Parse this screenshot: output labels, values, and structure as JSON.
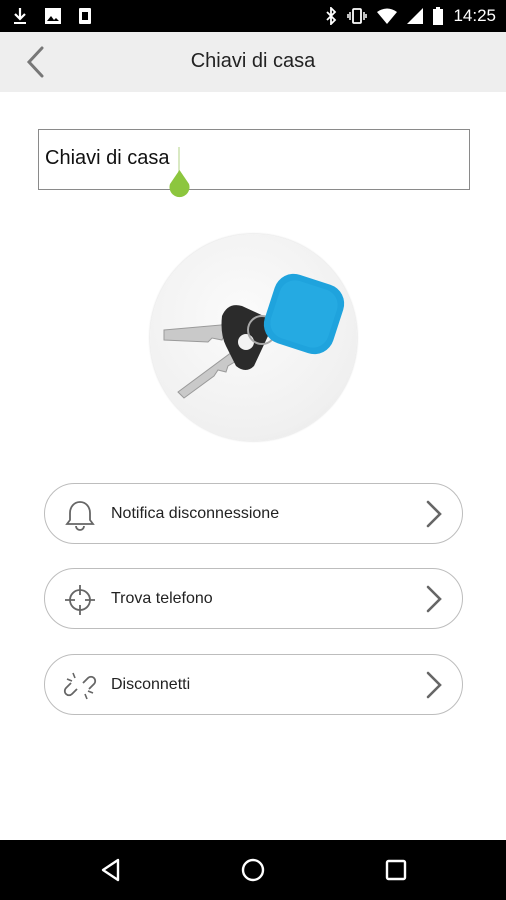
{
  "status_bar": {
    "time": "14:25",
    "left_icons": [
      "download-icon",
      "image-icon",
      "clipboard-icon"
    ],
    "right_icons": [
      "bluetooth-icon",
      "vibrate-icon",
      "wifi-icon",
      "signal-icon",
      "battery-icon"
    ]
  },
  "toolbar": {
    "title": "Chiavi di casa"
  },
  "name_field": {
    "value": "Chiavi di casa"
  },
  "device_image": {
    "description_icon": "keychain-tag-image"
  },
  "options": [
    {
      "label": "Notifica disconnessione",
      "icon": "bell-icon"
    },
    {
      "label": "Trova telefono",
      "icon": "crosshair-icon"
    },
    {
      "label": "Disconnetti",
      "icon": "broken-link-icon"
    }
  ],
  "colors": {
    "accent": "#8cc63e",
    "tag_blue": "#1fa3dd",
    "toolbar_bg": "#eeeeee"
  }
}
